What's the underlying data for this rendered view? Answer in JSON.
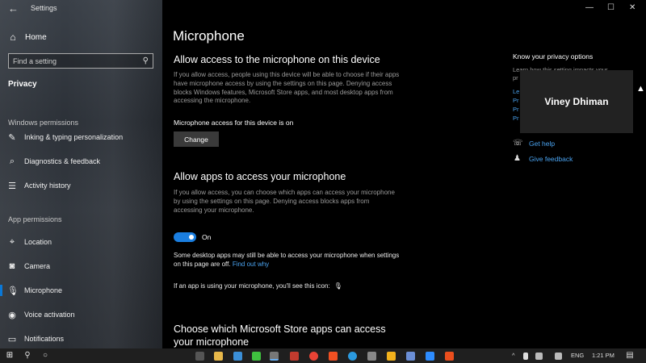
{
  "window": {
    "app_title": "Settings",
    "back_icon": "←",
    "minimize_icon": "—",
    "maximize_icon": "☐",
    "close_icon": "✕"
  },
  "sidebar": {
    "home": {
      "icon": "⌂",
      "label": "Home"
    },
    "search": {
      "placeholder": "Find a setting",
      "icon": "⚲"
    },
    "current_section": "Privacy",
    "windows_permissions_label": "Windows permissions",
    "windows_permissions_items": [
      {
        "icon": "✎",
        "label": "Inking & typing personalization"
      },
      {
        "icon": "⌕",
        "label": "Diagnostics & feedback"
      },
      {
        "icon": "☰",
        "label": "Activity history"
      }
    ],
    "app_permissions_label": "App permissions",
    "app_permissions_items": [
      {
        "icon": "⌖",
        "label": "Location"
      },
      {
        "icon": "◙",
        "label": "Camera"
      },
      {
        "icon": "🎙",
        "label": "Microphone"
      },
      {
        "icon": "◉",
        "label": "Voice activation"
      },
      {
        "icon": "▭",
        "label": "Notifications"
      }
    ]
  },
  "main": {
    "title": "Microphone",
    "section1": {
      "heading": "Allow access to the microphone on this device",
      "body": "If you allow access, people using this device will be able to choose if their apps have microphone access by using the settings on this page. Denying access blocks Windows features, Microsoft Store apps, and most desktop apps from accessing the microphone.",
      "status": "Microphone access for this device is on",
      "button": "Change"
    },
    "section2": {
      "heading": "Allow apps to access your microphone",
      "body": "If you allow access, you can choose which apps can access your microphone by using the settings on this page. Denying access blocks apps from accessing your microphone.",
      "toggle_label": "On",
      "note": "Some desktop apps may still be able to access your microphone when settings on this page are off.",
      "note_link": "Find out why",
      "mic_line": "If an app is using your microphone, you'll see this icon:",
      "mic_icon": "🎙"
    },
    "section3": {
      "heading": "Choose which Microsoft Store apps can access your microphone"
    }
  },
  "right_panel": {
    "heading": "Know your privacy options",
    "sub_visible": "Learn how this setting impacts your",
    "sub_p": "pr",
    "link_stubs": [
      "Le",
      "Pr",
      "Pr",
      "Pr"
    ],
    "overlay_name": "Viney Dhiman",
    "get_help": "Get help",
    "give_feedback": "Give feedback",
    "get_help_icon": "☏",
    "give_feedback_icon": "♟"
  },
  "taskbar": {
    "start_icon": "⊞",
    "search_icon": "⚲",
    "cortana_icon": "○",
    "tray": {
      "chevron": "^",
      "language": "ENG",
      "time": "1:21 PM",
      "notification_icon": "▤"
    }
  }
}
